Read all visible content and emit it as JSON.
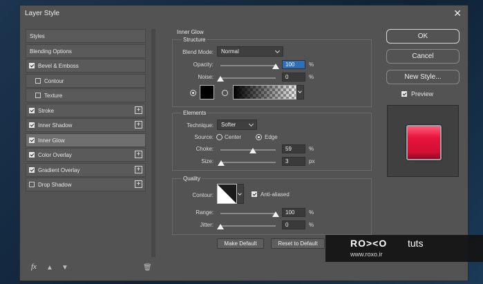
{
  "dialog": {
    "title": "Layer Style"
  },
  "style_list": {
    "items": [
      {
        "label": "Styles",
        "checkbox": false,
        "checked": false,
        "plus": false,
        "selected": false
      },
      {
        "label": "Blending Options",
        "checkbox": false,
        "checked": false,
        "plus": false,
        "selected": false
      },
      {
        "label": "Bevel & Emboss",
        "checkbox": true,
        "checked": true,
        "plus": false,
        "selected": false
      },
      {
        "label": "Contour",
        "checkbox": true,
        "checked": false,
        "plus": false,
        "selected": false,
        "indent": true
      },
      {
        "label": "Texture",
        "checkbox": true,
        "checked": false,
        "plus": false,
        "selected": false,
        "indent": true
      },
      {
        "label": "Stroke",
        "checkbox": true,
        "checked": true,
        "plus": true,
        "selected": false
      },
      {
        "label": "Inner Shadow",
        "checkbox": true,
        "checked": true,
        "plus": true,
        "selected": false
      },
      {
        "label": "Inner Glow",
        "checkbox": true,
        "checked": true,
        "plus": false,
        "selected": true
      },
      {
        "label": "Color Overlay",
        "checkbox": true,
        "checked": true,
        "plus": true,
        "selected": false
      },
      {
        "label": "Gradient Overlay",
        "checkbox": true,
        "checked": true,
        "plus": true,
        "selected": false
      },
      {
        "label": "Drop Shadow",
        "checkbox": true,
        "checked": false,
        "plus": true,
        "selected": false
      }
    ],
    "fx_label": "fx"
  },
  "panel": {
    "heading": "Inner Glow",
    "structure": {
      "heading": "Structure",
      "blend_mode_label": "Blend Mode:",
      "blend_mode_value": "Normal",
      "opacity_label": "Opacity:",
      "opacity_value": "100",
      "opacity_level": 100,
      "noise_label": "Noise:",
      "noise_value": "0",
      "noise_level": 0,
      "percent": "%"
    },
    "elements": {
      "heading": "Elements",
      "technique_label": "Technique:",
      "technique_value": "Softer",
      "source_label": "Source:",
      "source_center": "Center",
      "source_edge": "Edge",
      "choke_label": "Choke:",
      "choke_value": "59",
      "choke_level": 59,
      "size_label": "Size:",
      "size_value": "3",
      "size_level": 3,
      "px": "px",
      "percent": "%"
    },
    "quality": {
      "heading": "Quality",
      "contour_label": "Contour:",
      "anti_aliased_label": "Anti-aliased",
      "range_label": "Range:",
      "range_value": "100",
      "range_level": 100,
      "jitter_label": "Jitter:",
      "jitter_value": "0",
      "jitter_level": 0,
      "percent": "%"
    },
    "make_default": "Make Default",
    "reset_default": "Reset to Default"
  },
  "buttons": {
    "ok": "OK",
    "cancel": "Cancel",
    "new_style": "New Style...",
    "preview_label": "Preview"
  },
  "colors": {
    "glow_color": "#000000",
    "preview_fill": "#e8143c"
  },
  "watermark": {
    "brand": "RO><O",
    "tuts": "tuts",
    "url": "www.roxo.ir"
  }
}
